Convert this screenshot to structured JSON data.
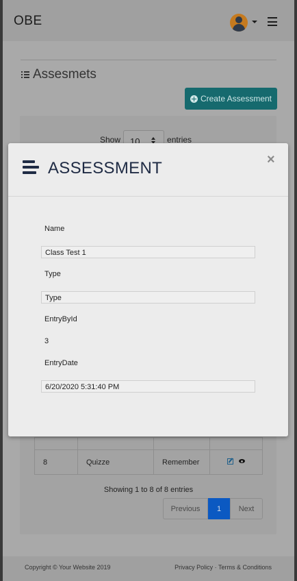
{
  "navbar": {
    "brand": "OBE"
  },
  "page": {
    "title": "Assesmets",
    "create_button": "Create Assessment",
    "length": {
      "show": "Show",
      "value": "10",
      "entries": "entries"
    },
    "table": {
      "rows": [
        {
          "id": "8",
          "name": "Quizze",
          "level": "Remember"
        }
      ]
    },
    "info": "Showing 1 to 8 of 8 entries",
    "pager": {
      "prev": "Previous",
      "current": "1",
      "next": "Next"
    }
  },
  "footer": {
    "copyright": "Copyright © Your Website 2019",
    "links": "Privacy Policy · Terms & Conditions"
  },
  "modal": {
    "title": "ASSESSMENT",
    "close": "×",
    "fields": {
      "name_label": "Name",
      "name_value": "Class Test 1",
      "type_label": "Type",
      "type_value": "Type",
      "entryby_label": "EntryById",
      "entryby_value": "3",
      "entrydate_label": "EntryDate",
      "entrydate_value": "6/20/2020 5:31:40 PM"
    }
  },
  "colors": {
    "accent_button": "#166a6e",
    "pager_active": "#0b59c2",
    "modal_title": "#1f2b44"
  }
}
